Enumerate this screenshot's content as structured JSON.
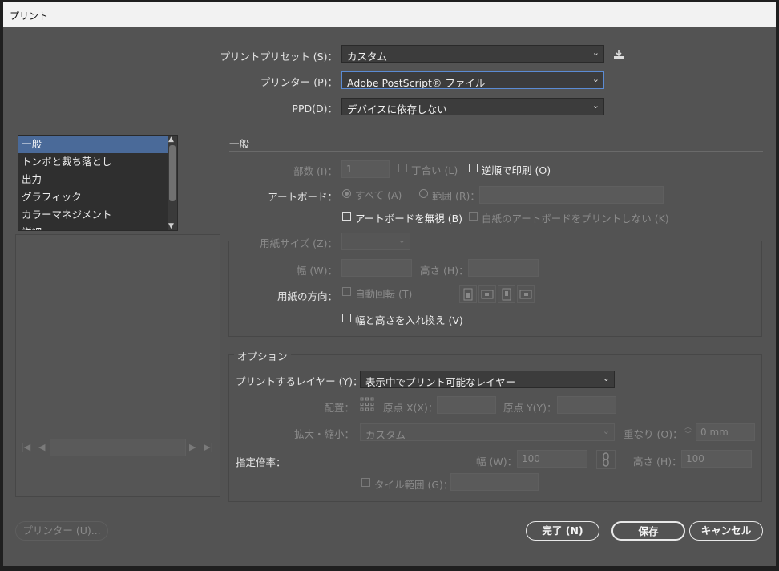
{
  "window": {
    "title": "プリント"
  },
  "header": {
    "preset_label": "プリントプリセット (S)：",
    "preset_value": "カスタム",
    "printer_label": "プリンター (P)：",
    "printer_value": "Adobe PostScript® ファイル",
    "ppd_label": "PPD(D)：",
    "ppd_value": "デバイスに依存しない"
  },
  "sidebar": {
    "items": [
      "一般",
      "トンボと裁ち落とし",
      "出力",
      "グラフィック",
      "カラーマネジメント",
      "詳細"
    ],
    "selected": "一般"
  },
  "general": {
    "section_title": "一般",
    "copies_label": "部数 (I)：",
    "copies_value": "1",
    "collate_label": "丁合い (L)",
    "reverse_label": "逆順で印刷 (O)",
    "artboard_label": "アートボード：",
    "all_label": "すべて (A)",
    "range_label": "範囲 (R)：",
    "ignore_artboards_label": "アートボードを無視 (B)",
    "skip_blank_label": "白紙のアートボードをプリントしない (K)"
  },
  "media": {
    "size_label": "用紙サイズ (Z)：",
    "width_label": "幅 (W)：",
    "height_label": "高さ (H)：",
    "orientation_label": "用紙の方向：",
    "auto_rotate_label": "自動回転 (T)",
    "swap_label": "幅と高さを入れ換え (V)"
  },
  "options": {
    "section_title": "オプション",
    "layers_label": "プリントするレイヤー (Y)：",
    "layers_value": "表示中でプリント可能なレイヤー",
    "placement_label": "配置：",
    "origin_x_label": "原点 X(X)：",
    "origin_y_label": "原点 Y(Y)：",
    "scaling_label": "拡大・縮小：",
    "scaling_value": "カスタム",
    "overlap_label": "重なり (O)：",
    "overlap_value": "0 mm",
    "scale_label": "指定倍率：",
    "scale_width_label": "幅 (W)：",
    "scale_width_value": "100",
    "scale_height_label": "高さ (H)：",
    "scale_height_value": "100",
    "tile_label": "タイル範囲 (G)："
  },
  "footer": {
    "printer_button": "プリンター (U)...",
    "done_button": "完了 (N)",
    "save_button": "保存",
    "cancel_button": "キャンセル"
  }
}
